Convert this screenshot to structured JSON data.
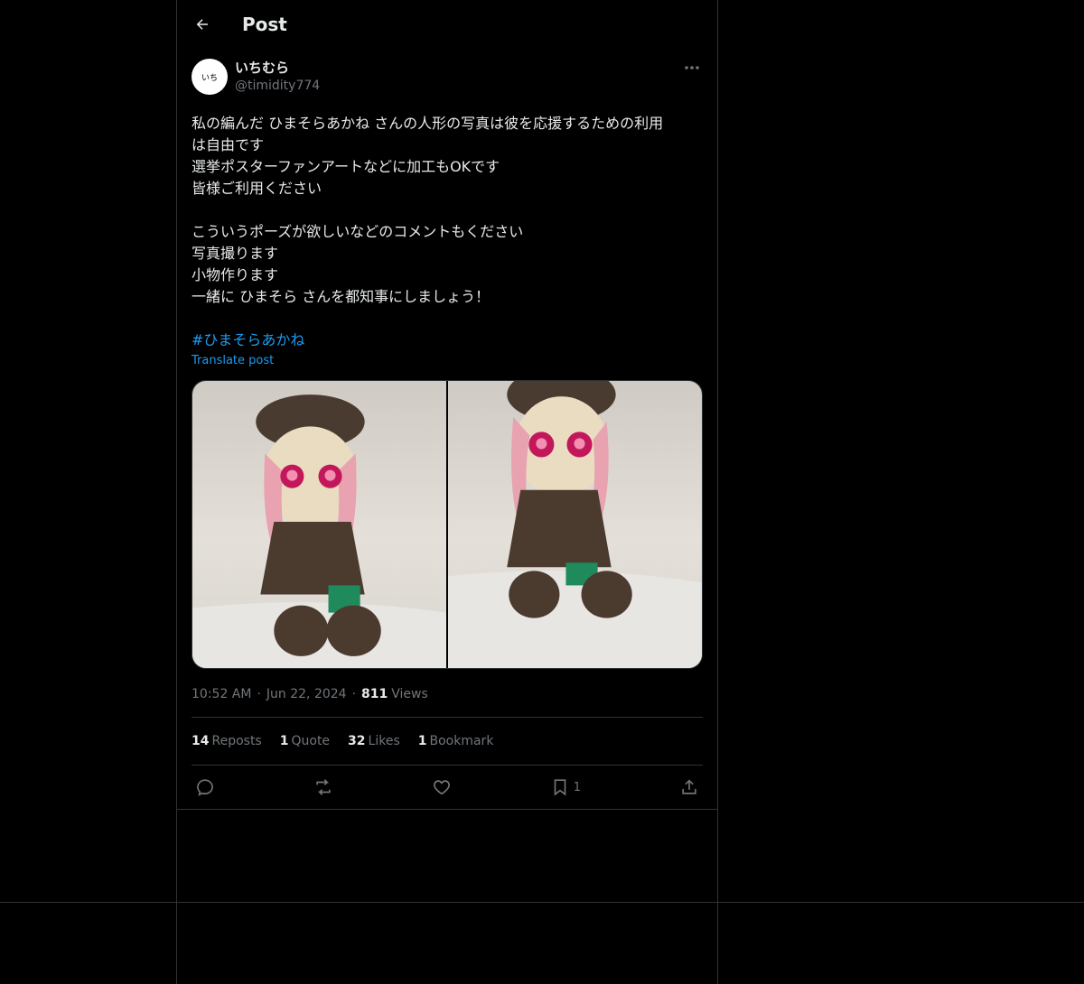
{
  "header": {
    "title": "Post"
  },
  "author": {
    "avatar_text": "いち",
    "display_name": "いちむら",
    "handle": "@timidity774"
  },
  "post": {
    "lines": [
      "私の編んだ ひまそらあかね さんの人形の写真は彼を応援するための利用",
      "は自由です",
      "選挙ポスターファンアートなどに加工もOKです",
      "皆様ご利用ください",
      "",
      "こういうポーズが欲しいなどのコメントもください",
      "写真撮ります",
      "小物作ります",
      "一緒に ひまそら さんを都知事にしましょう！"
    ],
    "hashtag": "#ひまそらあかね",
    "translate": "Translate post"
  },
  "meta": {
    "time": "10:52 AM",
    "date": "Jun 22, 2024",
    "views_count": "811",
    "views_label": "Views"
  },
  "stats": {
    "reposts_count": "14",
    "reposts_label": "Reposts",
    "quotes_count": "1",
    "quotes_label": "Quote",
    "likes_count": "32",
    "likes_label": "Likes",
    "bookmarks_count": "1",
    "bookmarks_label": "Bookmark"
  },
  "actions": {
    "bookmark_count": "1"
  },
  "icons": [
    "arrow-left-icon",
    "more-icon",
    "reply-icon",
    "repost-icon",
    "like-icon",
    "bookmark-icon",
    "share-icon"
  ],
  "colors": {
    "background": "#000000",
    "accent": "#1d9bf0",
    "muted": "#71767b",
    "text": "#e7e9ea",
    "border": "#2f3336"
  }
}
